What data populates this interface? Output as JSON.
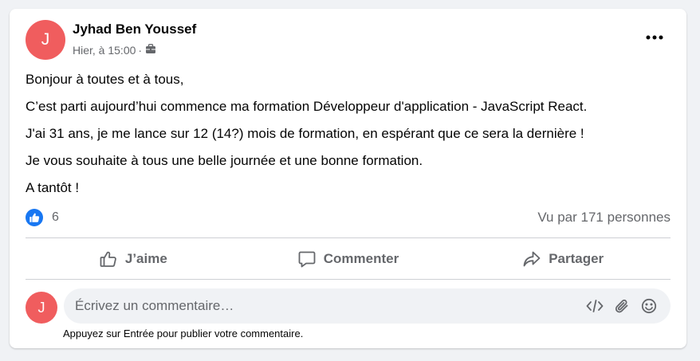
{
  "post": {
    "author": {
      "name": "Jyhad Ben Youssef",
      "initial": "J",
      "avatar_color": "#f05d5e"
    },
    "timestamp": "Hier, à 15:00",
    "audience_icon": "briefcase-icon",
    "body_lines": [
      "Bonjour à toutes et à tous,",
      "C’est parti aujourd’hui commence ma formation  Développeur d'application - JavaScript React.",
      "J'ai 31 ans, je me lance sur 12 (14?) mois de formation, en espérant que ce sera la dernière !",
      "Je vous souhaite à tous une belle journée et une bonne formation.",
      "A tantôt !"
    ],
    "reactions": {
      "icon": "like-icon",
      "count": "6",
      "color": "#1877f2"
    },
    "views": "Vu par 171 personnes"
  },
  "actions": {
    "like_label": "J’aime",
    "comment_label": "Commenter",
    "share_label": "Partager"
  },
  "comment": {
    "user_initial": "J",
    "placeholder": "Écrivez un commentaire…",
    "hint": "Appuyez sur Entrée pour publier votre commentaire."
  }
}
